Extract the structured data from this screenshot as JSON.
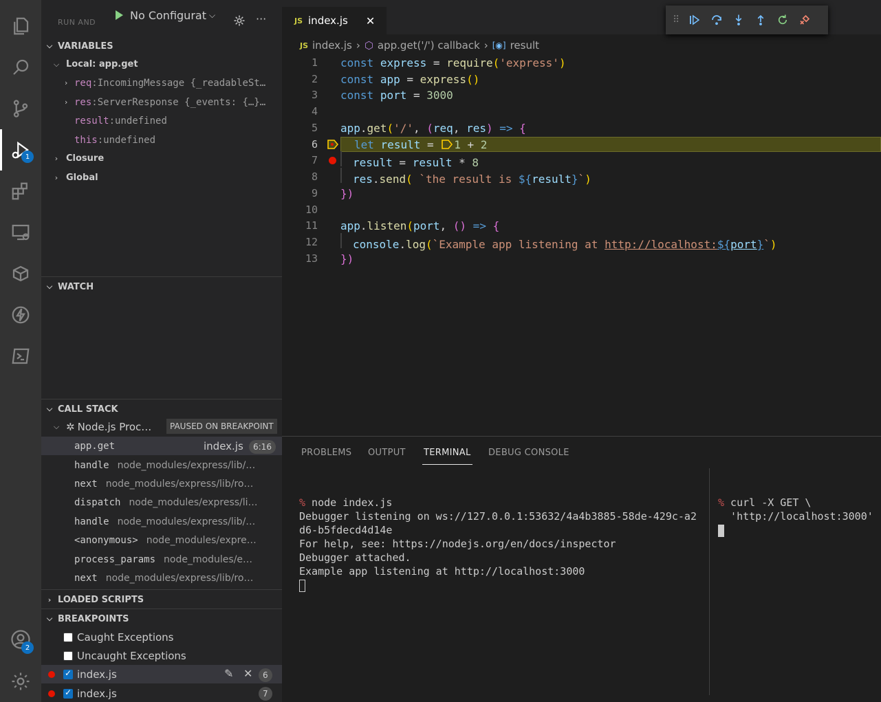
{
  "sidebar": {
    "run_label": "RUN AND",
    "config_label": "No Configurat",
    "variables": {
      "title": "VARIABLES",
      "local_scope": "Local: app.get",
      "items": [
        {
          "name": "req",
          "value": "IncomingMessage {_readableSt…"
        },
        {
          "name": "res",
          "value": "ServerResponse {_events: {…}…"
        },
        {
          "name": "result",
          "value": "undefined"
        },
        {
          "name": "this",
          "value": "undefined"
        }
      ],
      "closure": "Closure",
      "global": "Global"
    },
    "watch": {
      "title": "WATCH"
    },
    "call_stack": {
      "title": "CALL STACK",
      "process": "Node.js Proc…",
      "status": "PAUSED ON BREAKPOINT",
      "frames": [
        {
          "name": "app.get",
          "path": "index.js",
          "pos": "6:16"
        },
        {
          "name": "handle",
          "path": "node_modules/express/lib/…"
        },
        {
          "name": "next",
          "path": "node_modules/express/lib/ro…"
        },
        {
          "name": "dispatch",
          "path": "node_modules/express/li…"
        },
        {
          "name": "handle",
          "path": "node_modules/express/lib/…"
        },
        {
          "name": "<anonymous>",
          "path": "node_modules/expre…"
        },
        {
          "name": "process_params",
          "path": "node_modules/e…"
        },
        {
          "name": "next",
          "path": "node_modules/express/lib/ro…"
        }
      ]
    },
    "loaded_scripts": {
      "title": "LOADED SCRIPTS"
    },
    "breakpoints": {
      "title": "BREAKPOINTS",
      "caught": "Caught Exceptions",
      "uncaught": "Uncaught Exceptions",
      "items": [
        {
          "file": "index.js",
          "line": "6"
        },
        {
          "file": "index.js",
          "line": "7"
        }
      ]
    }
  },
  "activity": {
    "debug_badge": "1",
    "account_badge": "2",
    "icons": [
      "explorer-icon",
      "search-icon",
      "source-control-icon",
      "run-debug-icon",
      "extensions-icon",
      "remote-explorer-icon",
      "docker-icon",
      "thunder-icon",
      "powershell-icon",
      "account-icon",
      "settings-gear-icon"
    ]
  },
  "editor": {
    "tab_lang": "JS",
    "tab_label": "index.js",
    "breadcrumb": {
      "lang": "JS",
      "file": "index.js",
      "fn": "app.get('/') callback",
      "var": "result"
    },
    "lines": [
      "1",
      "2",
      "3",
      "4",
      "5",
      "6",
      "7",
      "8",
      "9",
      "10",
      "11",
      "12",
      "13"
    ],
    "code": {
      "l1": {
        "kw": "const",
        "name": "express",
        "op": " = ",
        "fn": "require",
        "open": "(",
        "str": "'express'",
        "close": ")"
      },
      "l2": {
        "kw": "const",
        "name": "app",
        "op": " = ",
        "fn": "express",
        "parens": "()"
      },
      "l3": {
        "kw": "const",
        "name": "port",
        "op": " = ",
        "num": "3000"
      },
      "l5": {
        "obj": "app",
        "dot": ".",
        "fn": "get",
        "open": "(",
        "str": "'/'",
        "comma": ", ",
        "po": "(",
        "a": "req",
        "c": ", ",
        "b": "res",
        "pc": ")",
        "arrow": " => ",
        "brace": "{"
      },
      "l6": {
        "kw": "let",
        "name": "result",
        "op": " = ",
        "n1": "1",
        "plus": " + ",
        "n2": "2"
      },
      "l7": {
        "name": "result",
        "op": " = ",
        "name2": "result",
        "mul": " * ",
        "num": "8"
      },
      "l8": {
        "obj": "res",
        "dot": ".",
        "fn": "send",
        "open": "( ",
        "str1": "`the result is ",
        "tpl_o": "${",
        "var": "result",
        "tpl_c": "}",
        "str2": "`",
        "close": ")"
      },
      "l9": {
        "close": "})"
      },
      "l11": {
        "obj": "app",
        "dot": ".",
        "fn": "listen",
        "open": "(",
        "arg": "port",
        "comma": ", ",
        "po": "()",
        "arrow": " => ",
        "brace": "{"
      },
      "l12": {
        "obj": "console",
        "dot": ".",
        "fn": "log",
        "open": "(",
        "str1": "`Example app listening at ",
        "url": "http://localhost:",
        "tpl_o": "${",
        "var": "port",
        "tpl_c": "}",
        "str2": "`",
        "close": ")"
      },
      "l13": {
        "close": "})"
      }
    }
  },
  "panel": {
    "tabs": [
      "PROBLEMS",
      "OUTPUT",
      "TERMINAL",
      "DEBUG CONSOLE"
    ],
    "terminal_left": {
      "prompt": "%",
      "cmd": " node index.js",
      "out1": "Debugger listening on ws://127.0.0.1:53632/4a4b3885-58de-429c-a2",
      "out2": "d6-b5fdecd4d14e",
      "out3": "For help, see: https://nodejs.org/en/docs/inspector",
      "out4": "Debugger attached.",
      "out5": "Example app listening at http://localhost:3000"
    },
    "terminal_right": {
      "prompt": "%",
      "cmd": " curl -X GET \\",
      "cont": "  'http://localhost:3000'"
    }
  }
}
